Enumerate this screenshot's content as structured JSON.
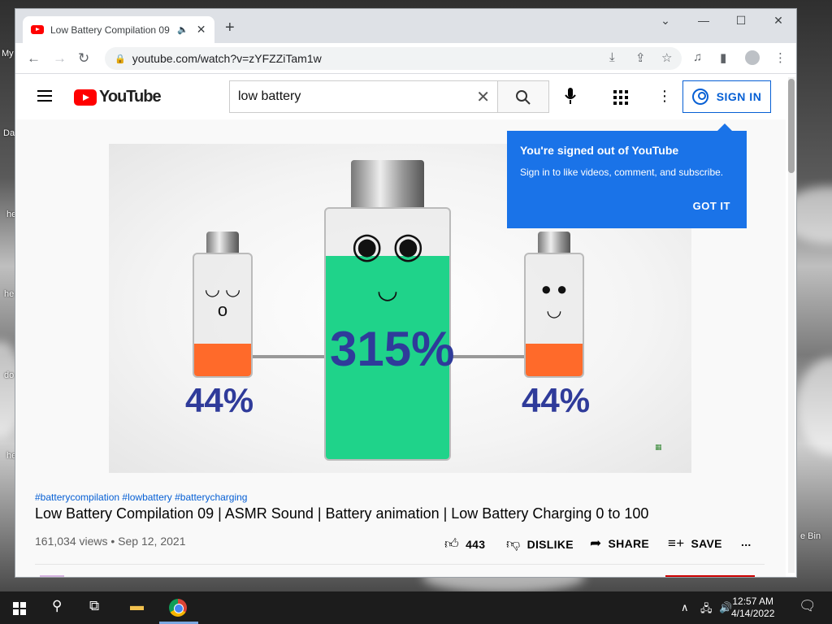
{
  "desktop": {
    "labels": [
      "My",
      "Da",
      "he",
      "he",
      "do",
      "he",
      "e Bin"
    ]
  },
  "browser": {
    "tab_title": "Low Battery Compilation 09 |",
    "new_tab": "+",
    "window_controls": {
      "minimize": "—",
      "maximize": "☐",
      "close": "✕",
      "tab_search": "⌄"
    },
    "url": "youtube.com/watch?v=zYFZZiTam1w"
  },
  "youtube": {
    "logo_text": "YouTube",
    "search": {
      "query": "low battery"
    },
    "sign_in_label": "SIGN IN",
    "popup": {
      "heading": "You're signed out of YouTube",
      "body": "Sign in to like videos, comment, and subscribe.",
      "button": "GOT IT"
    },
    "video": {
      "left_percent": "44%",
      "center_percent": "315%",
      "right_percent": "44%",
      "colors": {
        "orange": "#ff6a2a",
        "green": "#1fd38a",
        "text_blue": "#2f3b9a"
      }
    },
    "tags": "#batterycompilation #lowbattery #batterycharging",
    "title": "Low Battery Compilation 09 | ASMR Sound | Battery animation | Low Battery Charging 0 to 100",
    "views_date": "161,034 views • Sep 12, 2021",
    "actions": {
      "likes": "443",
      "dislike": "DISLIKE",
      "share": "SHARE",
      "save": "SAVE",
      "more": "..."
    }
  },
  "taskbar": {
    "time": "12:57 AM",
    "date": "4/14/2022"
  }
}
